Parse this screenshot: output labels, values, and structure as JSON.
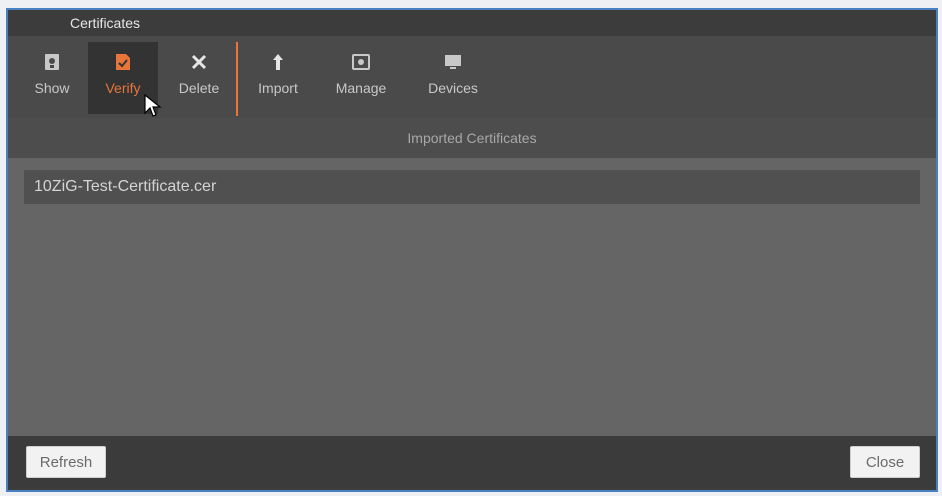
{
  "window": {
    "title": "Certificates"
  },
  "toolbar": {
    "items": [
      {
        "label": "Show",
        "icon": "certificate-icon"
      },
      {
        "label": "Verify",
        "icon": "verify-document-icon",
        "active": true
      },
      {
        "label": "Delete",
        "icon": "close-icon"
      },
      {
        "label": "Import",
        "icon": "arrow-up-icon"
      },
      {
        "label": "Manage",
        "icon": "gear-icon"
      },
      {
        "label": "Devices",
        "icon": "monitor-icon"
      }
    ]
  },
  "section": {
    "title": "Imported Certificates"
  },
  "certificates": [
    "10ZiG-Test-Certificate.cer"
  ],
  "footer": {
    "refresh_label": "Refresh",
    "close_label": "Close"
  },
  "colors": {
    "accent": "#e8763a",
    "window_border": "#4a7fc1"
  }
}
